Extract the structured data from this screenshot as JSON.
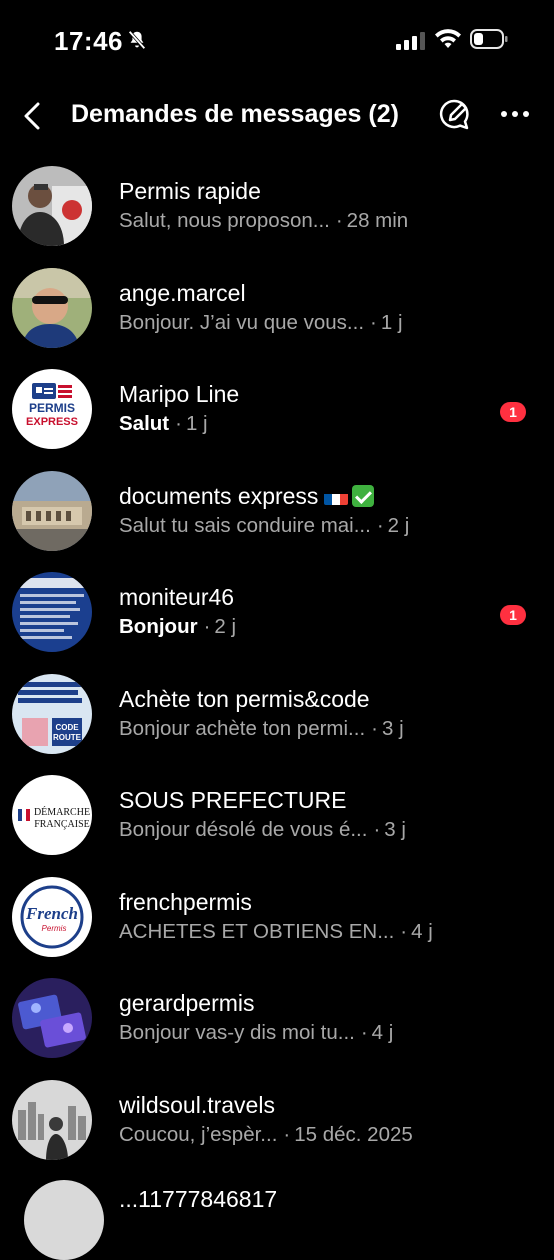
{
  "status_bar": {
    "time": "17:46",
    "icons": [
      "bell-slash-icon",
      "signal-icon",
      "wifi-icon",
      "battery-icon"
    ]
  },
  "header": {
    "title": "Demandes de messages (2)",
    "back_icon": "chevron-left-icon",
    "compose_icon": "compose-icon",
    "more_icon": "more-icon"
  },
  "colors": {
    "background": "#000000",
    "secondary_text": "#a8a8a8",
    "badge": "#ff3040"
  },
  "requests": [
    {
      "name": "Permis rapide",
      "preview": "Salut, nous proposon...",
      "ago": "28 min",
      "unread": false,
      "badge": ""
    },
    {
      "name": "ange.marcel",
      "preview": "Bonjour. J’ai vu que vous...",
      "ago": "1 j",
      "unread": false,
      "badge": ""
    },
    {
      "name": "Maripo Line",
      "preview": "Salut",
      "ago": "1 j",
      "unread": true,
      "badge": "1"
    },
    {
      "name": "documents express",
      "preview": "Salut tu sais conduire mai...",
      "ago": "2 j",
      "unread": false,
      "badge": ""
    },
    {
      "name": "moniteur46",
      "preview": "Bonjour",
      "ago": "2 j",
      "unread": true,
      "badge": "1"
    },
    {
      "name": "Achète ton permis&code",
      "preview": "Bonjour achète ton permi...",
      "ago": "3 j",
      "unread": false,
      "badge": ""
    },
    {
      "name": "SOUS PREFECTURE",
      "preview": "Bonjour désolé de vous é...",
      "ago": "3 j",
      "unread": false,
      "badge": ""
    },
    {
      "name": "frenchpermis",
      "preview": "ACHETES ET OBTIENS EN...",
      "ago": "4 j",
      "unread": false,
      "badge": ""
    },
    {
      "name": "gerardpermis",
      "preview": "Bonjour vas-y dis moi tu...",
      "ago": "4 j",
      "unread": false,
      "badge": ""
    },
    {
      "name": "wildsoul.travels",
      "preview": "Coucou, j’espèr...",
      "ago": "15 déc. 2025",
      "unread": false,
      "badge": ""
    }
  ],
  "avatar_texts": {
    "permis_express": [
      "PERMIS",
      "EXPRESS"
    ],
    "code_route": [
      "CODE",
      "ROUTE"
    ],
    "demarche": [
      "DÉMARCHE",
      "FRANÇAISE"
    ],
    "french": [
      "French",
      "Permis"
    ]
  },
  "partial_row_name": "...11777846817"
}
